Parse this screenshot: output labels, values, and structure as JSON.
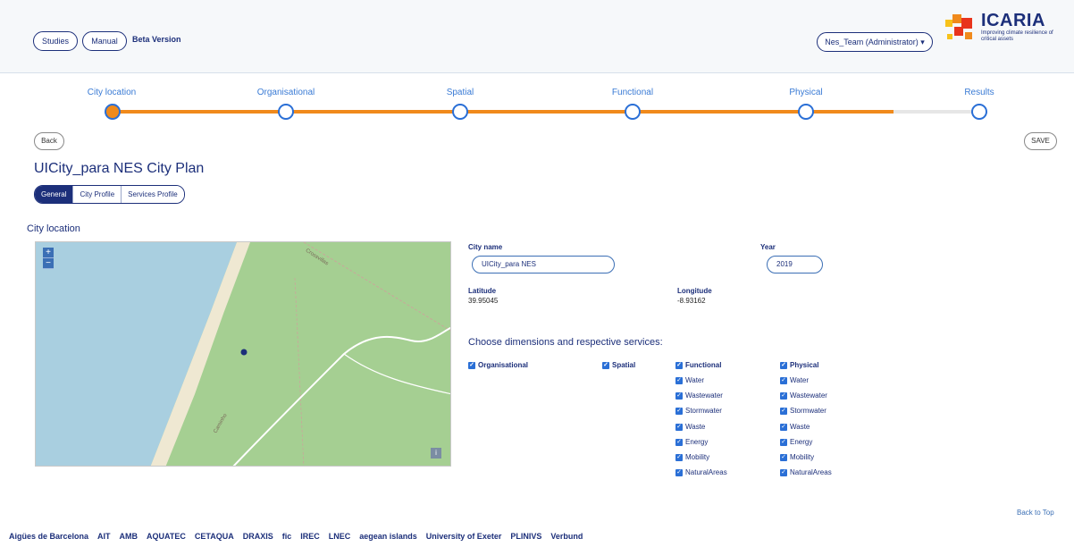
{
  "header": {
    "studies_label": "Studies",
    "manual_label": "Manual",
    "beta_label": "Beta Version",
    "user_label": "Nes_Team (Administrator) ▾",
    "logo_text": "ICARIA",
    "logo_tagline": "Improving climate resilience of critical assets"
  },
  "steps": [
    {
      "label": "City location"
    },
    {
      "label": "Organisational"
    },
    {
      "label": "Spatial"
    },
    {
      "label": "Functional"
    },
    {
      "label": "Physical"
    },
    {
      "label": "Results"
    }
  ],
  "progress": {
    "active_step": 0,
    "fill_fraction": 0.9
  },
  "actions": {
    "back_label": "Back",
    "save_label": "SAVE",
    "back_to_top": "Back to Top"
  },
  "page": {
    "title": "UICity_para NES City Plan",
    "section_title": "City location"
  },
  "tabs": [
    {
      "label": "General"
    },
    {
      "label": "City Profile"
    },
    {
      "label": "Services Profile"
    }
  ],
  "map": {
    "zoom_in": "+",
    "zoom_out": "−",
    "info": "i",
    "road_labels": [
      "Crossvillas",
      "Caminho"
    ]
  },
  "form": {
    "city_name_label": "City name",
    "city_name_value": "UICity_para NES",
    "year_label": "Year",
    "year_value": "2019",
    "latitude_label": "Latitude",
    "latitude_value": "39.95045",
    "longitude_label": "Longitude",
    "longitude_value": "-8.93162",
    "choose_label": "Choose dimensions and respective services:"
  },
  "dimensions": {
    "organisational": "Organisational",
    "spatial": "Spatial",
    "functional": "Functional",
    "physical": "Physical",
    "functional_services": [
      "Water",
      "Wastewater",
      "Stormwater",
      "Waste",
      "Energy",
      "Mobility",
      "NaturalAreas"
    ],
    "physical_services": [
      "Water",
      "Wastewater",
      "Stormwater",
      "Waste",
      "Energy",
      "Mobility",
      "NaturalAreas"
    ]
  },
  "footer": {
    "sponsors": [
      "Aigües de Barcelona",
      "AIT",
      "AMB",
      "AQUATEC",
      "CETAQUA",
      "DRAXIS",
      "fic",
      "IREC",
      "LNEC",
      "aegean islands",
      "University of Exeter",
      "PLINIVS",
      "Verbund"
    ]
  },
  "colors": {
    "primary": "#1c2f7a",
    "accent": "#f08a1c",
    "link": "#3b6fb5",
    "map_land": "#a5cf92",
    "map_sea": "#a9cfe0"
  }
}
